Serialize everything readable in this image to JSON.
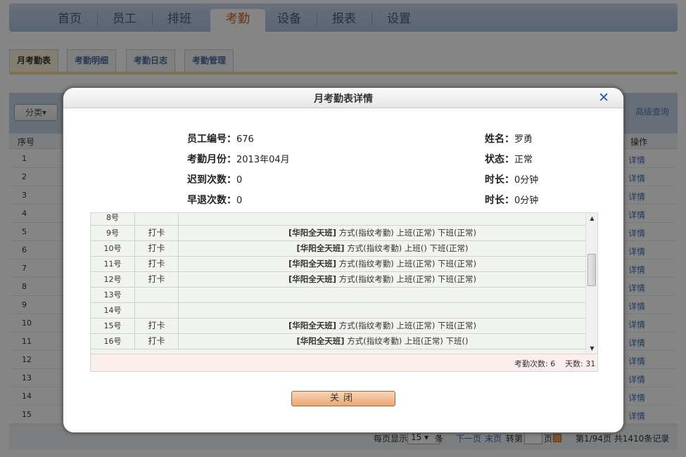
{
  "nav": {
    "tabs": [
      "首页",
      "员工",
      "排班",
      "考勤",
      "设备",
      "报表",
      "设置"
    ],
    "active_index": 3
  },
  "subnav": {
    "tabs": [
      "月考勤表",
      "考勤明细",
      "考勤日志",
      "考勤管理"
    ],
    "active_index": 0
  },
  "toolbar": {
    "filter_label": "分类",
    "advanced_search": "高级查询"
  },
  "grid": {
    "col_index": "序号",
    "col_op": "操作",
    "rows": [
      "1",
      "2",
      "3",
      "4",
      "5",
      "6",
      "7",
      "8",
      "9",
      "10",
      "11",
      "12",
      "13",
      "14",
      "15"
    ],
    "row_action": "详情"
  },
  "pager": {
    "per_page_label": "每页显示",
    "per_page_value": "15",
    "per_page_unit": "条",
    "next": "下一页",
    "last": "末页",
    "goto_label": "转第",
    "goto_unit": "页",
    "summary": "第1/94页 共1410条记录"
  },
  "modal": {
    "title": "月考勤表详情",
    "close_icon": "close-icon",
    "fields": {
      "emp_no_label": "员工编号：",
      "emp_no": "676",
      "month_label": "考勤月份：",
      "month": "2013年04月",
      "late_label": "迟到次数：",
      "late": "0",
      "early_label": "早退次数：",
      "early": "0",
      "name_label": "姓名：",
      "name": "罗勇",
      "status_label": "状态：",
      "status": "正常",
      "dur1_label": "时长：",
      "dur1": "0分钟",
      "dur2_label": "时长：",
      "dur2": "0分钟"
    },
    "rows": [
      {
        "day": "8号",
        "type": "",
        "shift": "",
        "detail": ""
      },
      {
        "day": "9号",
        "type": "打卡",
        "shift": "[华阳全天班]",
        "detail": " 方式(指纹考勤) 上班(正常) 下班(正常)"
      },
      {
        "day": "10号",
        "type": "打卡",
        "shift": "[华阳全天班]",
        "detail": " 方式(指纹考勤) 上班() 下班(正常)"
      },
      {
        "day": "11号",
        "type": "打卡",
        "shift": "[华阳全天班]",
        "detail": " 方式(指纹考勤) 上班(正常) 下班(正常)"
      },
      {
        "day": "12号",
        "type": "打卡",
        "shift": "[华阳全天班]",
        "detail": " 方式(指纹考勤) 上班(正常) 下班(正常)"
      },
      {
        "day": "13号",
        "type": "",
        "shift": "",
        "detail": ""
      },
      {
        "day": "14号",
        "type": "",
        "shift": "",
        "detail": ""
      },
      {
        "day": "15号",
        "type": "打卡",
        "shift": "[华阳全天班]",
        "detail": " 方式(指纹考勤) 上班(正常) 下班(正常)"
      },
      {
        "day": "16号",
        "type": "打卡",
        "shift": "[华阳全天班]",
        "detail": " 方式(指纹考勤) 上班(正常) 下班()"
      }
    ],
    "footer": {
      "attend_count": "考勤次数: 6",
      "days": "天数: 31"
    },
    "close_button": "关闭"
  }
}
